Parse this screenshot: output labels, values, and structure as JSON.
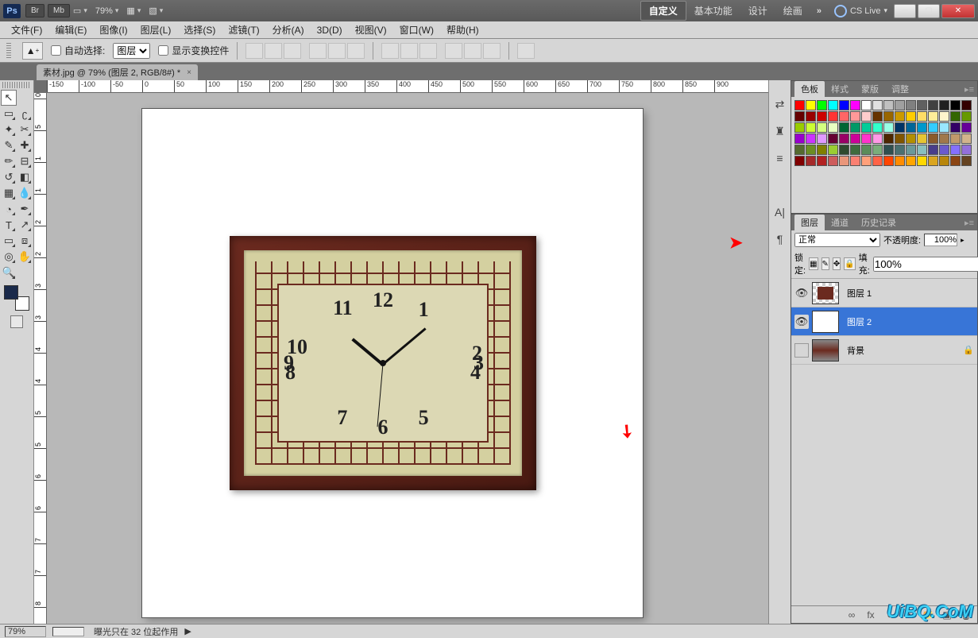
{
  "titlebar": {
    "ps": "Ps",
    "br": "Br",
    "mb": "Mb",
    "zoom": "79%",
    "mode_custom": "自定义",
    "mode_basic": "基本功能",
    "mode_design": "设计",
    "mode_paint": "绘画",
    "more": "»",
    "cs_live": "CS Live"
  },
  "menu": {
    "file": "文件(F)",
    "edit": "编辑(E)",
    "image": "图像(I)",
    "layer": "图层(L)",
    "select": "选择(S)",
    "filter": "滤镜(T)",
    "analysis": "分析(A)",
    "3d": "3D(D)",
    "view": "视图(V)",
    "window": "窗口(W)",
    "help": "帮助(H)"
  },
  "options": {
    "auto_select": "自动选择:",
    "auto_select_target": "图层",
    "show_transform": "显示变换控件"
  },
  "doc_tab": {
    "title": "素材.jpg @ 79% (图层 2, RGB/8#) *"
  },
  "ruler_h": [
    "-150",
    "-100",
    "-50",
    "0",
    "50",
    "100",
    "150",
    "200",
    "250",
    "300",
    "350",
    "400",
    "450",
    "500",
    "550",
    "600",
    "650",
    "700",
    "750",
    "800",
    "850",
    "900"
  ],
  "ruler_v": [
    "0",
    "5",
    "1",
    "1",
    "2",
    "2",
    "3",
    "3",
    "4",
    "4",
    "5",
    "5",
    "6",
    "6",
    "7",
    "7",
    "8"
  ],
  "clock_numbers": {
    "n1": "1",
    "n2": "2",
    "n3": "3",
    "n4": "4",
    "n5": "5",
    "n6": "6",
    "n7": "7",
    "n8": "8",
    "n9": "9",
    "n10": "10",
    "n11": "11",
    "n12": "12"
  },
  "panels": {
    "swatches": {
      "tab1": "色板",
      "tab2": "样式",
      "tab3": "蒙版",
      "tab4": "调整"
    },
    "layers": {
      "tab_layer": "图层",
      "tab_channel": "通道",
      "tab_history": "历史记录",
      "blend": "正常",
      "opacity_lbl": "不透明度:",
      "opacity_val": "100%",
      "lock_lbl": "锁定:",
      "fill_lbl": "填充:",
      "fill_val": "100%",
      "items": [
        {
          "name": "图层 1",
          "visible": true,
          "sel": false,
          "thumb": "clock"
        },
        {
          "name": "图层 2",
          "visible": true,
          "sel": true,
          "thumb": "white"
        },
        {
          "name": "背景",
          "visible": false,
          "sel": false,
          "thumb": "bg",
          "locked": true
        }
      ]
    }
  },
  "status": {
    "zoom": "79%",
    "text": "曝光只在 32 位起作用"
  },
  "swatch_colors": [
    "#ff0000",
    "#ffff00",
    "#00ff00",
    "#00ffff",
    "#0000ff",
    "#ff00ff",
    "#ffffff",
    "#e0e0e0",
    "#c0c0c0",
    "#a0a0a0",
    "#808080",
    "#606060",
    "#404040",
    "#202020",
    "#000000",
    "#330000",
    "#660000",
    "#990000",
    "#cc0000",
    "#ff3333",
    "#ff6666",
    "#ff9999",
    "#ffcccc",
    "#663300",
    "#996600",
    "#cc9900",
    "#ffcc00",
    "#ffdd66",
    "#ffee99",
    "#fff4cc",
    "#336600",
    "#669900",
    "#99cc00",
    "#ccff33",
    "#d4ff80",
    "#e8ffc2",
    "#006633",
    "#009966",
    "#00cc99",
    "#33ffcc",
    "#99ffe6",
    "#003366",
    "#006699",
    "#0099cc",
    "#33ccff",
    "#99e6ff",
    "#330066",
    "#660099",
    "#9900cc",
    "#cc33ff",
    "#e099ff",
    "#660033",
    "#990066",
    "#cc0099",
    "#ff33cc",
    "#ff99e6",
    "#4d2600",
    "#805500",
    "#b38f00",
    "#e6c533",
    "#8b5a2b",
    "#a0784b",
    "#c19a6b",
    "#d2b48c",
    "#556b2f",
    "#6b8e23",
    "#808000",
    "#9acd32",
    "#2e4a2e",
    "#3e6b3e",
    "#5a8c5a",
    "#7aad7a",
    "#2f4f4f",
    "#4a7070",
    "#6b9999",
    "#8abfbf",
    "#483d8b",
    "#6a5acd",
    "#8470ff",
    "#9370db",
    "#800000",
    "#a52a2a",
    "#b22222",
    "#cd5c5c",
    "#e9967a",
    "#fa8072",
    "#ffa07a",
    "#ff6347",
    "#ff4500",
    "#ff8c00",
    "#ffa500",
    "#ffd700",
    "#daa520",
    "#b8860b",
    "#8b4513",
    "#654321"
  ],
  "watermark": "UiBQ.CoM"
}
